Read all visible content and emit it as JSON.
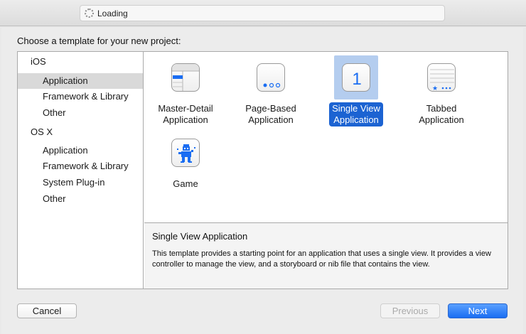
{
  "toolbar": {
    "activity_label": "Loading"
  },
  "dialog": {
    "prompt": "Choose a template for your new project:",
    "sidebar": {
      "sections": [
        {
          "label": "iOS",
          "items": [
            "Application",
            "Framework & Library",
            "Other"
          ]
        },
        {
          "label": "OS X",
          "items": [
            "Application",
            "Framework & Library",
            "System Plug-in",
            "Other"
          ]
        }
      ],
      "selected": "iOS / Application"
    },
    "templates": [
      {
        "label_line1": "Master-Detail",
        "label_line2": "Application",
        "icon": "master-detail-icon"
      },
      {
        "label_line1": "Page-Based",
        "label_line2": "Application",
        "icon": "page-based-icon"
      },
      {
        "label_line1": "Single View",
        "label_line2": "Application",
        "icon": "single-view-icon",
        "icon_text": "1",
        "selected": true
      },
      {
        "label_line1": "Tabbed",
        "label_line2": "Application",
        "icon": "tabbed-icon"
      },
      {
        "label_line1": "Game",
        "label_line2": "",
        "icon": "game-icon"
      }
    ],
    "description": {
      "title": "Single View Application",
      "body": "This template provides a starting point for an application that uses a single view. It provides a view controller to manage the view, and a storyboard or nib file that contains the view."
    },
    "buttons": {
      "cancel": "Cancel",
      "previous": "Previous",
      "next": "Next"
    }
  },
  "colors": {
    "selection_blue": "#1c63d2",
    "icon_blue": "#1a6df2"
  }
}
